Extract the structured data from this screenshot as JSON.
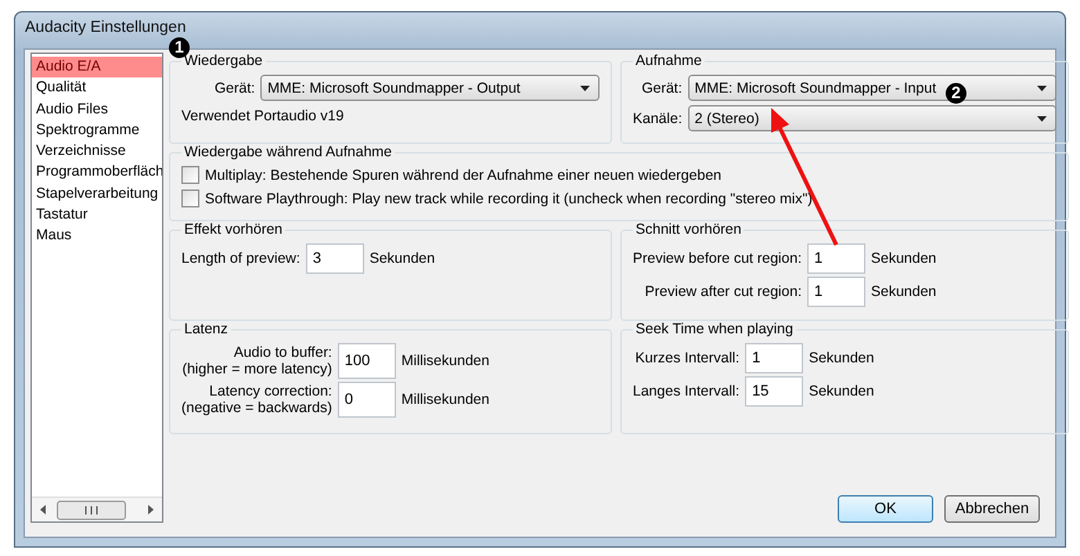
{
  "window": {
    "title": "Audacity Einstellungen"
  },
  "sidebar": {
    "items": [
      {
        "label": "Audio E/A",
        "selected": true
      },
      {
        "label": "Qualität",
        "selected": false
      },
      {
        "label": "Audio Files",
        "selected": false
      },
      {
        "label": "Spektrogramme",
        "selected": false
      },
      {
        "label": "Verzeichnisse",
        "selected": false
      },
      {
        "label": "Programmoberfläch",
        "selected": false
      },
      {
        "label": "Stapelverarbeitung",
        "selected": false
      },
      {
        "label": "Tastatur",
        "selected": false
      },
      {
        "label": "Maus",
        "selected": false
      }
    ]
  },
  "playback": {
    "title": "Wiedergabe",
    "device": {
      "label": "Gerät:",
      "value": "MME: Microsoft Soundmapper - Output"
    },
    "note": "Verwendet Portaudio v19"
  },
  "recording": {
    "title": "Aufnahme",
    "device": {
      "label": "Gerät:",
      "value": "MME: Microsoft Soundmapper - Input"
    },
    "channels": {
      "label": "Kanäle:",
      "value": "2 (Stereo)"
    }
  },
  "playthrough": {
    "title": "Wiedergabe während Aufnahme",
    "options": [
      {
        "label": "Multiplay: Bestehende Spuren während der Aufnahme einer neuen wiedergeben",
        "checked": false
      },
      {
        "label": "Software Playthrough: Play new track while recording it (uncheck when recording \"stereo mix\")",
        "checked": false
      }
    ]
  },
  "effect_preview": {
    "title": "Effekt vorhören",
    "fields": [
      {
        "label": [
          "Length of preview:"
        ],
        "value": "3",
        "unit": "Sekunden"
      }
    ]
  },
  "cut_preview": {
    "title": "Schnitt vorhören",
    "fields": [
      {
        "label": [
          "Preview before cut region:"
        ],
        "value": "1",
        "unit": "Sekunden"
      },
      {
        "label": [
          "Preview after cut region:"
        ],
        "value": "1",
        "unit": "Sekunden"
      }
    ]
  },
  "latency": {
    "title": "Latenz",
    "fields": [
      {
        "label": [
          "Audio to buffer:",
          "(higher = more latency)"
        ],
        "value": "100",
        "unit": "Millisekunden"
      },
      {
        "label": [
          "Latency correction:",
          "(negative = backwards)"
        ],
        "value": "0",
        "unit": "Millisekunden"
      }
    ]
  },
  "seek": {
    "title": "Seek Time when playing",
    "fields": [
      {
        "label": [
          "Kurzes Intervall:"
        ],
        "value": "1",
        "unit": "Sekunden"
      },
      {
        "label": [
          "Langes Intervall:"
        ],
        "value": "15",
        "unit": "Sekunden"
      }
    ]
  },
  "buttons": [
    {
      "label": "OK",
      "default": true
    },
    {
      "label": "Abbrechen",
      "default": false
    }
  ],
  "annotations": [
    {
      "label": "1"
    },
    {
      "label": "2"
    }
  ]
}
